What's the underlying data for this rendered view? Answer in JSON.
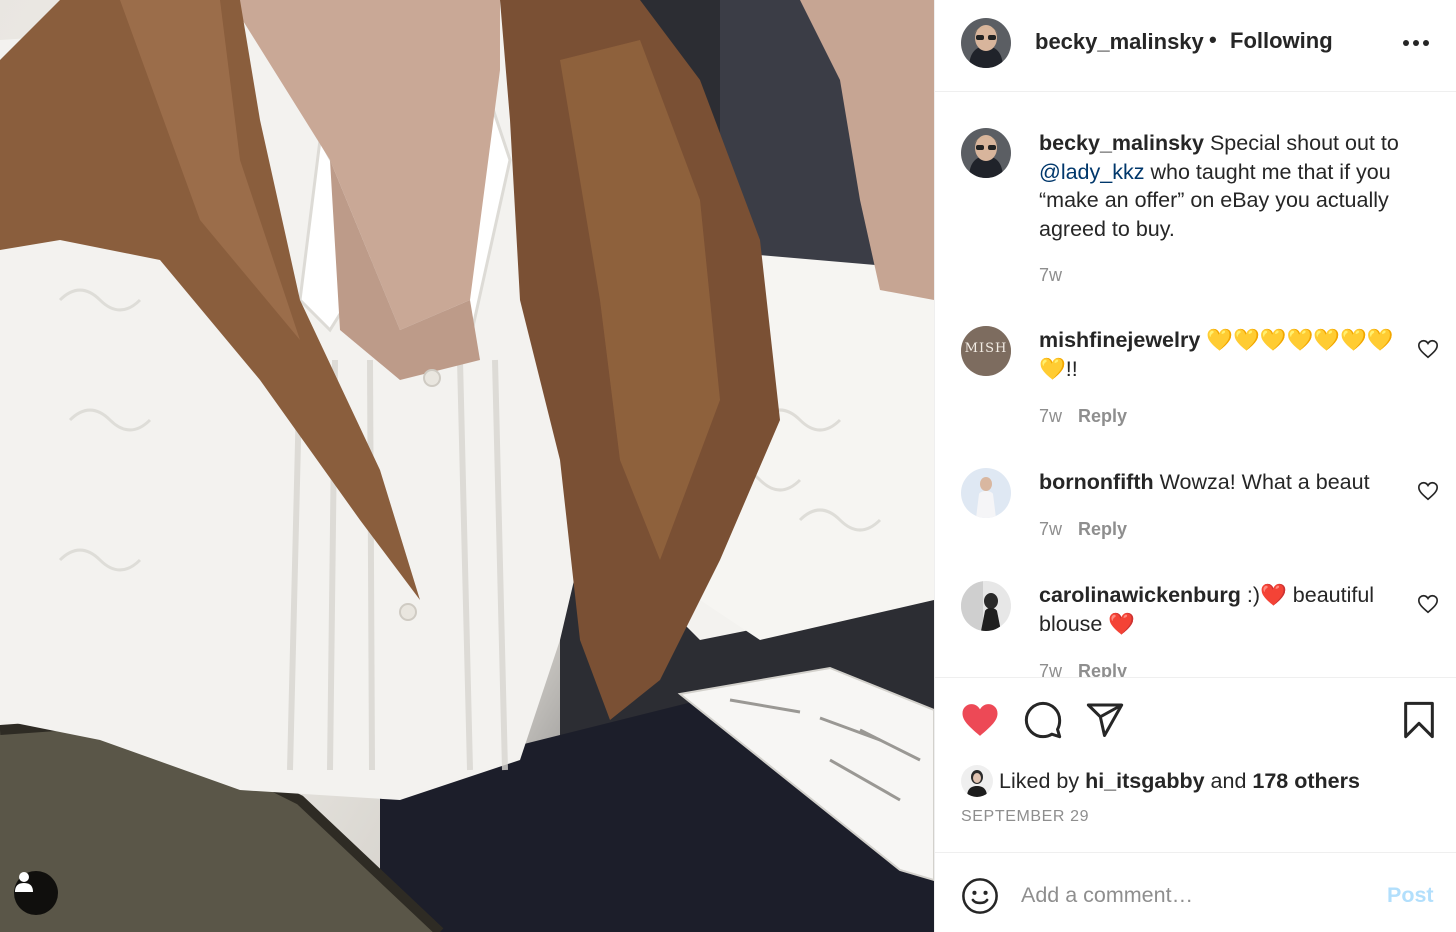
{
  "post": {
    "username": "becky_malinsky",
    "separator": "•",
    "follow_status": "Following"
  },
  "caption": {
    "username": "becky_malinsky",
    "text_before": "Special shout out to",
    "mention": "@lady_kkz",
    "text_after": "who taught me that if you “make an offer” on eBay you actually agreed to buy.",
    "time": "7w"
  },
  "comments": [
    {
      "username": "mishfinejewelry",
      "text": "💛💛💛💛💛💛💛💛!!",
      "time": "7w",
      "reply": "Reply",
      "avatar_text": "MISH"
    },
    {
      "username": "bornonfifth",
      "text": "Wowza! What a beaut",
      "time": "7w",
      "reply": "Reply"
    },
    {
      "username": "carolinawickenburg",
      "text": ":)❤️ beautiful blouse ❤️",
      "time": "7w",
      "reply": "Reply"
    }
  ],
  "likes": {
    "prefix": "Liked by",
    "user": "hi_itsgabby",
    "joiner": "and",
    "others": "178 others"
  },
  "date": "SEPTEMBER 29",
  "add_comment": {
    "placeholder": "Add a comment…",
    "post_label": "Post"
  },
  "icons": {
    "more": "more-horizontal-icon",
    "like": "heart-filled-icon",
    "comment": "comment-bubble-icon",
    "share": "paper-plane-icon",
    "save": "bookmark-icon",
    "emoji": "smiley-icon",
    "tag": "user-tag-icon"
  },
  "colors": {
    "like_red": "#ed4956",
    "mention_blue": "#00376b",
    "post_disabled": "#b2dffc",
    "meta_gray": "#8e8e8e"
  }
}
